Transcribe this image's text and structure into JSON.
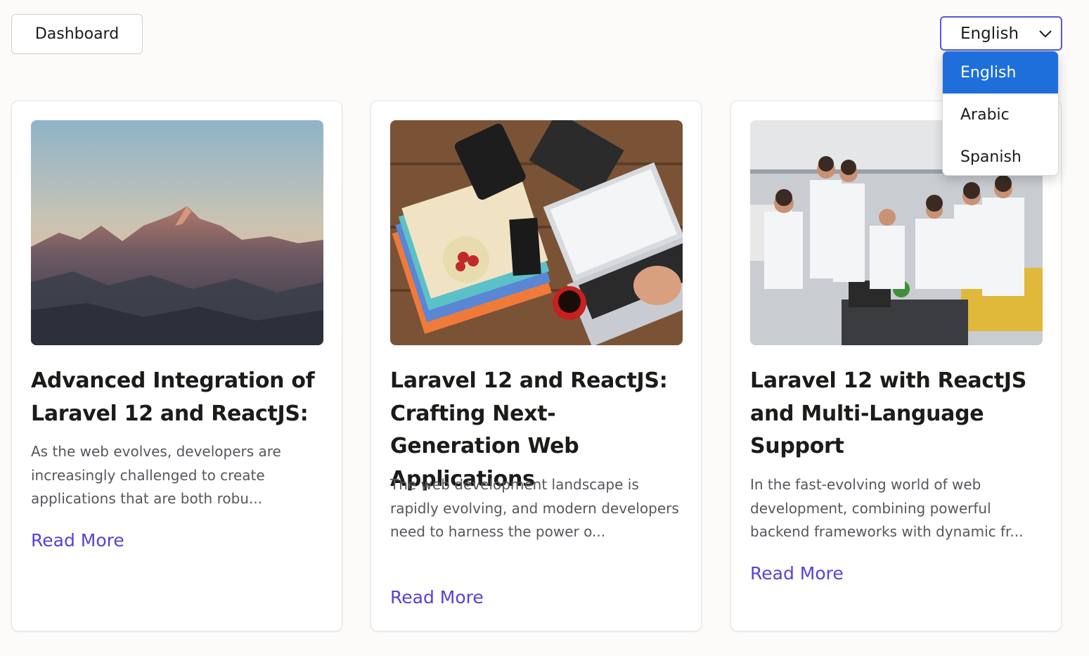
{
  "header": {
    "dashboard_label": "Dashboard",
    "language_select": {
      "value": "English",
      "options": [
        "English",
        "Arabic",
        "Spanish"
      ],
      "selected_index": 0
    }
  },
  "colors": {
    "accent": "#5b3fd6",
    "select_border": "#5b56d6",
    "option_selected_bg": "#1e6fdc"
  },
  "posts": [
    {
      "image": "mountain-peak-sunset",
      "title": "Advanced Integration of Laravel 12 and ReactJS:",
      "excerpt": "As the web evolves, developers are increasingly challenged to create applications that are both robu...",
      "read_more": "Read More"
    },
    {
      "image": "desk-laptop-blog",
      "title": "Laravel 12 and ReactJS: Crafting Next-Generation Web Applications",
      "excerpt": "The web development landscape is rapidly evolving, and modern developers need to harness the power o...",
      "read_more": "Read More"
    },
    {
      "image": "team-meeting-office",
      "title": "Laravel 12 with ReactJS and Multi-Language Support",
      "excerpt": "In the fast-evolving world of web development, combining powerful backend frameworks with dynamic fr...",
      "read_more": "Read More"
    }
  ]
}
